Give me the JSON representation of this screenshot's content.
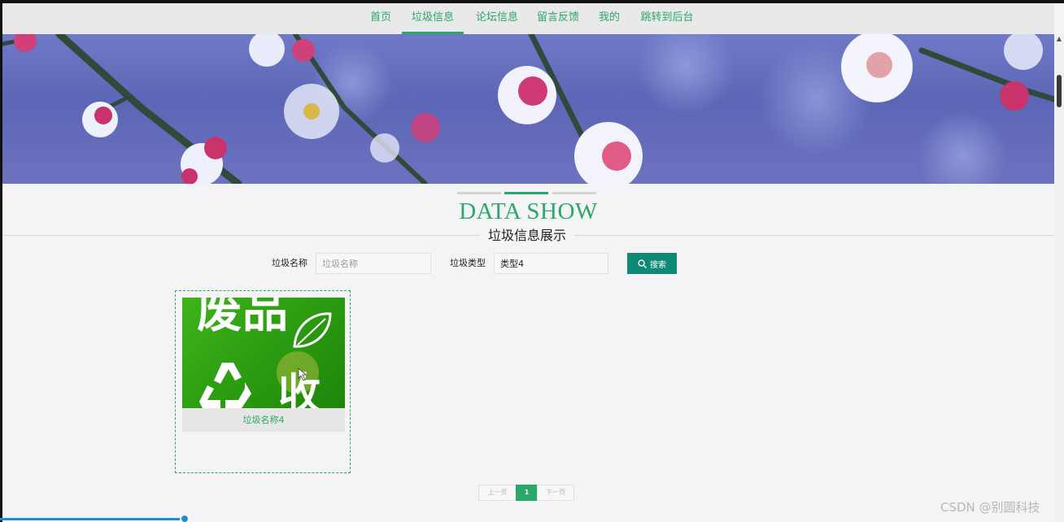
{
  "nav": {
    "items": [
      {
        "label": "首页",
        "active": false
      },
      {
        "label": "垃圾信息",
        "active": true
      },
      {
        "label": "论坛信息",
        "active": false
      },
      {
        "label": "留言反馈",
        "active": false
      },
      {
        "label": "我的",
        "active": false
      },
      {
        "label": "跳转到后台",
        "active": false
      }
    ]
  },
  "section": {
    "title_en": "DATA SHOW",
    "title_zh": "垃圾信息展示"
  },
  "search": {
    "name_label": "垃圾名称",
    "name_placeholder": "垃圾名称",
    "name_value": "",
    "type_label": "垃圾类型",
    "type_value": "类型4",
    "button_label": "搜索"
  },
  "cards": [
    {
      "name": "垃圾名称4",
      "image_text_top": "废品",
      "image_text_bottom": "收"
    }
  ],
  "pagination": {
    "prev_label": "上一页",
    "current_page": "1",
    "next_label": "下一页"
  },
  "watermark": "CSDN @别圆科技",
  "colors": {
    "accent": "#2aa86a",
    "button": "#0e8a76",
    "nav_bg": "#e9e9e9",
    "page_bg": "#f4f3f5"
  }
}
